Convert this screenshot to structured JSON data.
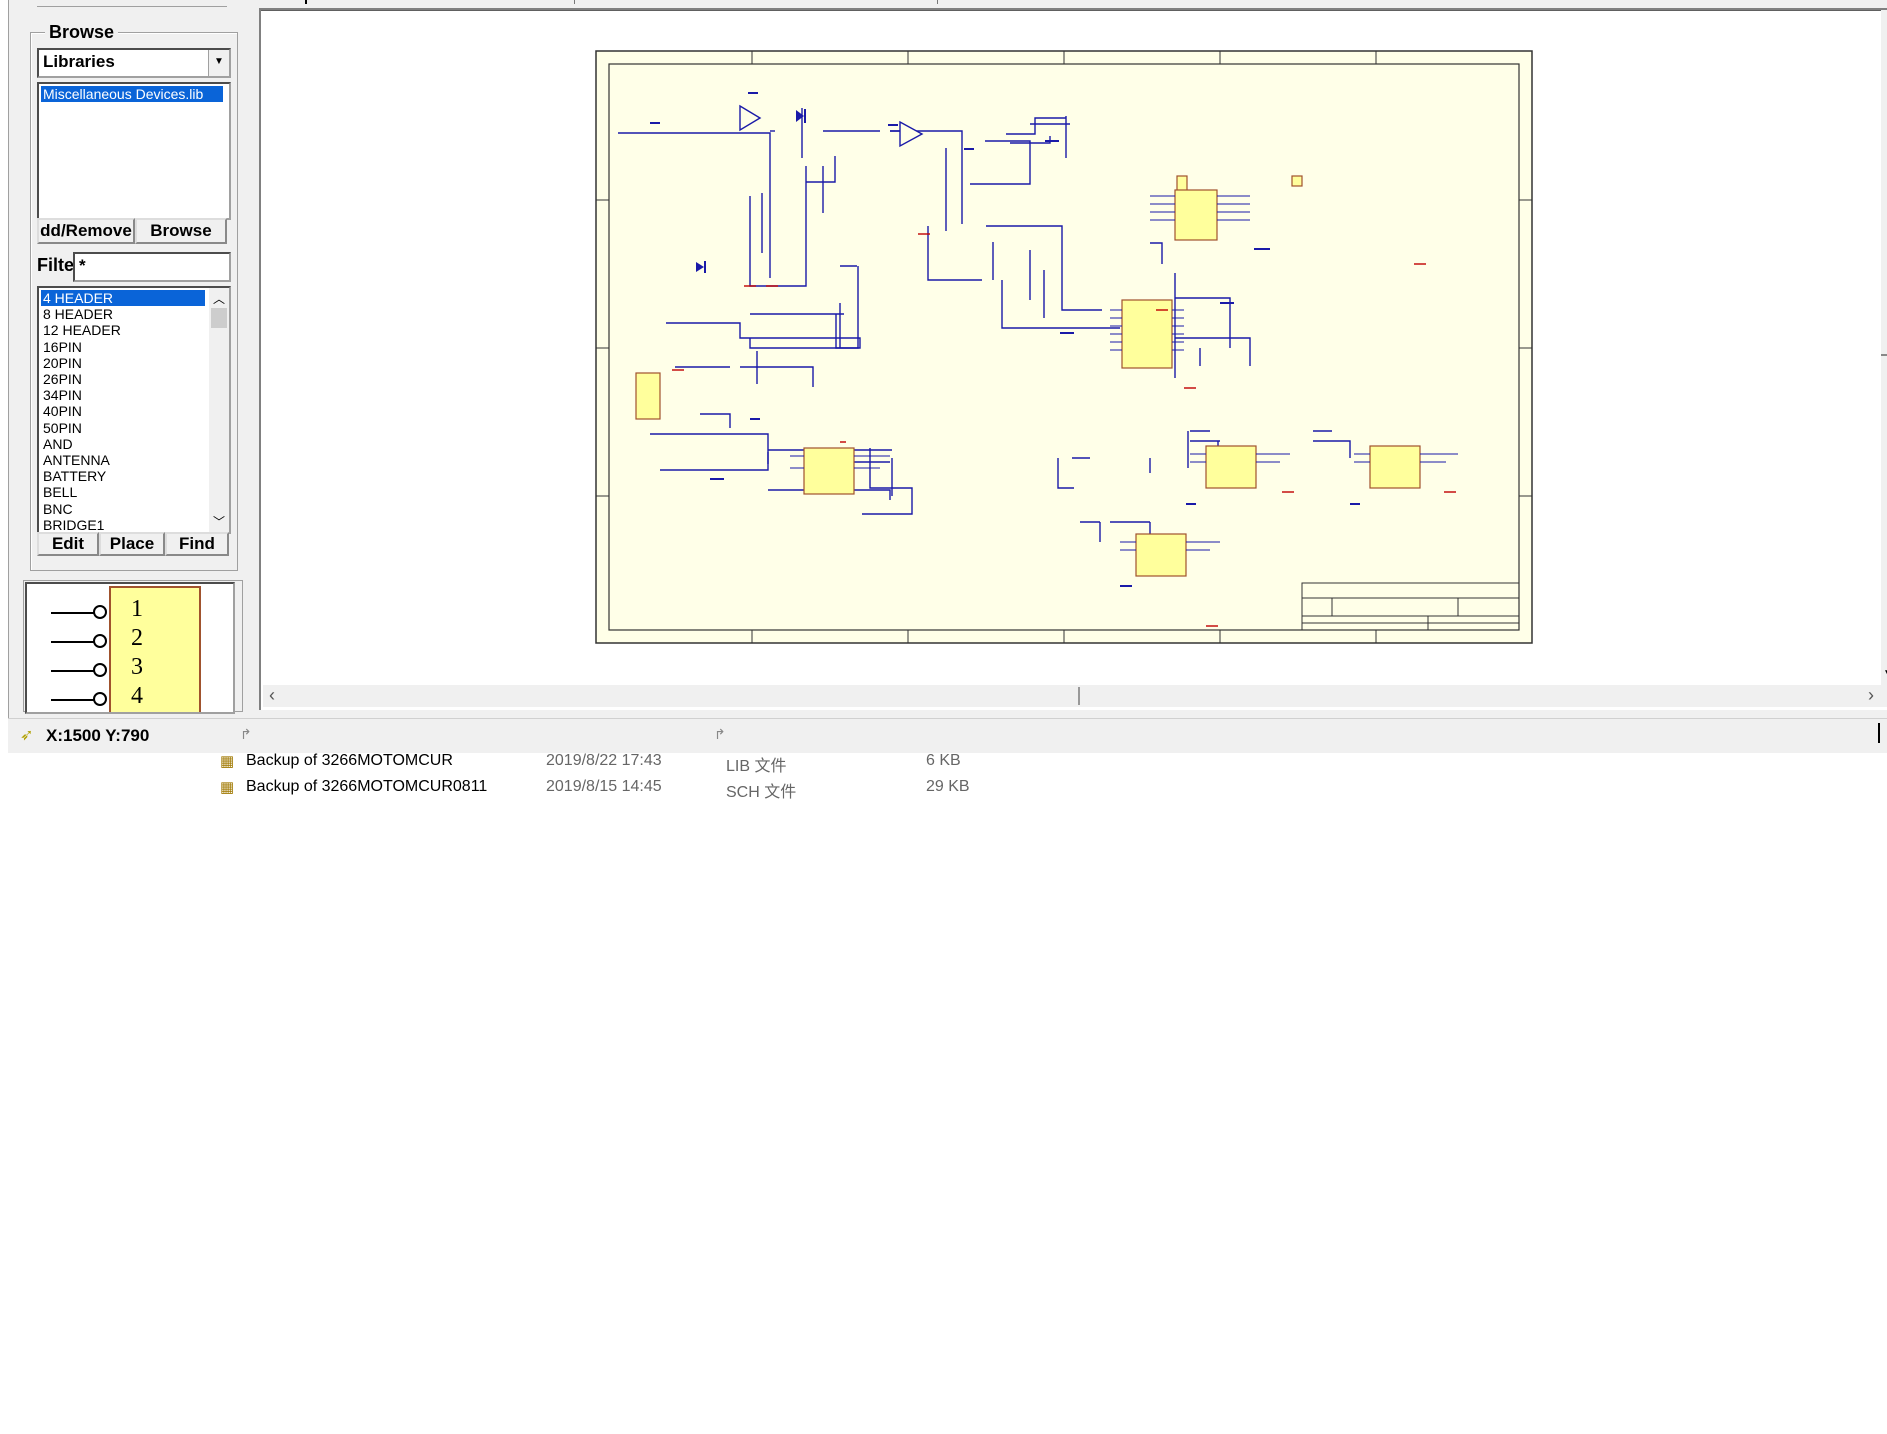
{
  "browse_panel": {
    "group_label": "Browse",
    "mode_select": {
      "value": "Libraries"
    },
    "libraries": [
      {
        "label": "Miscellaneous Devices.lib",
        "selected": true
      }
    ],
    "add_remove_label": "dd/Remove",
    "browse_label": "Browse",
    "filter_label": "Filte",
    "filter_value": "*",
    "components": [
      {
        "label": "4 HEADER",
        "selected": true
      },
      {
        "label": "8 HEADER"
      },
      {
        "label": "12 HEADER"
      },
      {
        "label": "16PIN"
      },
      {
        "label": "20PIN"
      },
      {
        "label": "26PIN"
      },
      {
        "label": "34PIN"
      },
      {
        "label": "40PIN"
      },
      {
        "label": "50PIN"
      },
      {
        "label": "AND"
      },
      {
        "label": "ANTENNA"
      },
      {
        "label": "BATTERY"
      },
      {
        "label": "BELL"
      },
      {
        "label": "BNC"
      },
      {
        "label": "BRIDGE1"
      }
    ],
    "edit_label": "Edit",
    "place_label": "Place",
    "find_label": "Find",
    "preview_pins": [
      "1",
      "2",
      "3",
      "4"
    ]
  },
  "status_bar": {
    "coords": "X:1500 Y:790"
  },
  "file_list": [
    {
      "name": "Backup of 3266MOTOMCUR",
      "date": "2019/8/22 17:43",
      "type": "LIB 文件",
      "size": "6 KB"
    },
    {
      "name": "Backup of 3266MOTOMCUR0811",
      "date": "2019/8/15 14:45",
      "type": "SCH 文件",
      "size": "29 KB"
    }
  ],
  "colors": {
    "selection": "#0a64d8",
    "sheet_fill": "#ffffe8",
    "wire": "#1a1aa8",
    "part_fill": "#ffff9c",
    "part_border": "#a0522d"
  }
}
